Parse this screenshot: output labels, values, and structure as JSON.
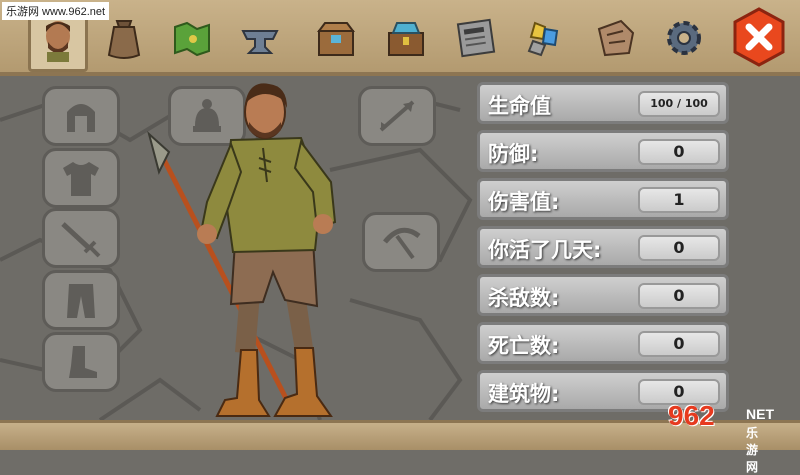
{
  "watermark": {
    "top_left": "乐游网 www.962.net"
  },
  "tabs": [
    {
      "icon": "character-portrait-icon",
      "active": true
    },
    {
      "icon": "sack-icon"
    },
    {
      "icon": "map-icon"
    },
    {
      "icon": "anvil-icon"
    },
    {
      "icon": "crafting-chest-icon"
    },
    {
      "icon": "treasure-chest-icon"
    },
    {
      "icon": "news-icon"
    },
    {
      "icon": "gems-icon"
    },
    {
      "icon": "scroll-map-icon"
    },
    {
      "icon": "settings-gear-icon"
    }
  ],
  "close_button": {
    "icon": "close-icon",
    "color": "#e9481e"
  },
  "equipment_slots": [
    {
      "name": "helmet-slot",
      "icon": "helmet-icon"
    },
    {
      "name": "hat-slot",
      "icon": "hat-icon"
    },
    {
      "name": "ammo-slot",
      "icon": "arrow-icon"
    },
    {
      "name": "chest-slot",
      "icon": "shirt-icon"
    },
    {
      "name": "weapon-slot",
      "icon": "sword-icon"
    },
    {
      "name": "tool-slot",
      "icon": "pickaxe-icon"
    },
    {
      "name": "legs-slot",
      "icon": "pants-icon"
    },
    {
      "name": "boots-slot",
      "icon": "boot-icon"
    }
  ],
  "stats": [
    {
      "label": "生命值",
      "value": "100 / 100"
    },
    {
      "label": "防御:",
      "value": "0"
    },
    {
      "label": "伤害值:",
      "value": "1"
    },
    {
      "label": "你活了几天:",
      "value": "0"
    },
    {
      "label": "杀敌数:",
      "value": "0"
    },
    {
      "label": "死亡数:",
      "value": "0"
    },
    {
      "label": "建筑物:",
      "value": "0"
    }
  ],
  "brand": {
    "number": "962",
    "net": "NET",
    "cn": "乐游网"
  }
}
